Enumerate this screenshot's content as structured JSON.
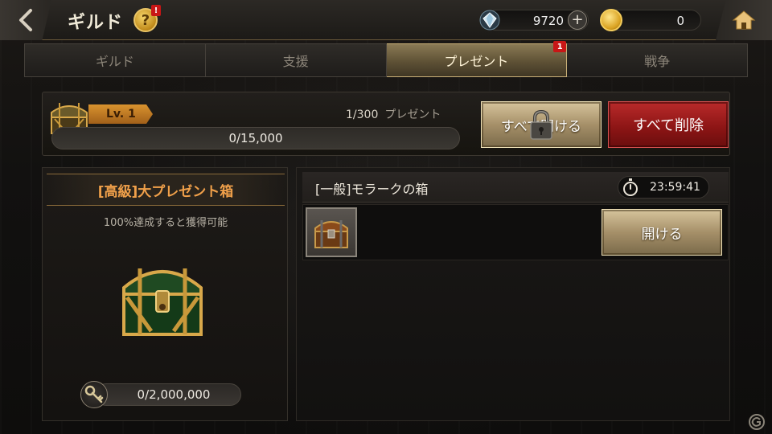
{
  "header": {
    "title": "ギルド",
    "help_label": "?",
    "help_badge": "!",
    "gem_value": "9720",
    "plus_label": "+",
    "gold_value": "0"
  },
  "tabs": [
    {
      "label": "ギルド",
      "active": false
    },
    {
      "label": "支援",
      "active": false
    },
    {
      "label": "プレゼント",
      "active": true,
      "badge": "1"
    },
    {
      "label": "戦争",
      "active": false
    }
  ],
  "level_panel": {
    "level": "Lv. 1",
    "present_count": "1/300",
    "present_label": "プレゼント",
    "progress_text": "0/15,000",
    "progress_fraction": 0
  },
  "buttons": {
    "open_all": "すべて開ける",
    "delete_all": "すべて削除",
    "open": "開ける"
  },
  "left_panel": {
    "title": "[高級]大プレゼント箱",
    "subtitle": "100%達成すると獲得可能",
    "key_progress": "0/2,000,000"
  },
  "gift_item": {
    "title": "[一般]モラークの箱",
    "timer": "23:59:41"
  },
  "colors": {
    "accent_gold": "#c9b078",
    "title_orange": "#f0a04a",
    "delete_red": "#8a1414",
    "badge_red": "#c81616"
  }
}
